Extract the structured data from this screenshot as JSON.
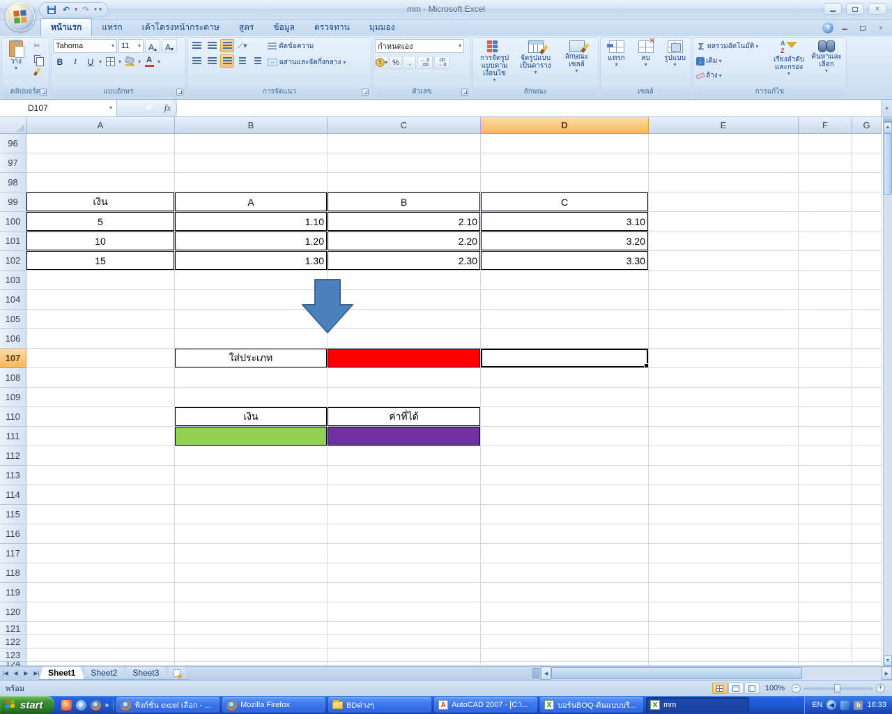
{
  "window": {
    "title": "mm - Microsoft Excel"
  },
  "ribbon_tabs": [
    {
      "label": "หน้าแรก",
      "active": true
    },
    {
      "label": "แทรก"
    },
    {
      "label": "เค้าโครงหน้ากระดาษ"
    },
    {
      "label": "สูตร"
    },
    {
      "label": "ข้อมูล"
    },
    {
      "label": "ตรวจทาน"
    },
    {
      "label": "มุมมอง"
    }
  ],
  "ribbon": {
    "clipboard": {
      "label": "คลิปบอร์ด",
      "paste": "วาง"
    },
    "font": {
      "label": "แบบอักษร",
      "font_name": "Tahoma",
      "font_size": "11",
      "bold": "B",
      "italic": "I",
      "underline": "U"
    },
    "alignment": {
      "label": "การจัดแนว",
      "wrap_text": "ตัดข้อความ",
      "merge_center": "ผสานและจัดกึ่งกลาง"
    },
    "number": {
      "label": "ตัวเลข",
      "format": "กำหนดเอง",
      "percent": "%",
      "comma": ","
    },
    "styles": {
      "label": "ลักษณะ",
      "conditional": "การจัดรูปแบบตามเงื่อนไข",
      "format_table": "จัดรูปแบบเป็นตาราง",
      "cell_styles": "ลักษณะเซลล์"
    },
    "cells": {
      "label": "เซลล์",
      "insert": "แทรก",
      "delete": "ลบ",
      "format": "รูปแบบ"
    },
    "editing": {
      "label": "การแก้ไข",
      "autosum": "ผลรวมอัตโนมัติ",
      "fill": "เติม",
      "clear": "ล้าง",
      "sort_filter": "เรียงลำดับและกรอง",
      "find_select": "ค้นหาและเลือก"
    }
  },
  "formula_bar": {
    "name_box": "D107",
    "fx": "fx",
    "value": ""
  },
  "grid": {
    "columns": [
      "A",
      "B",
      "C",
      "D",
      "E",
      "F",
      "G"
    ],
    "selected_column": "D",
    "row_start": 96,
    "row_end": 124,
    "selected_row": 107,
    "selected_cell": "D107",
    "cells": [
      {
        "r": 99,
        "c": "A",
        "v": "เงิน",
        "align": "center",
        "border": true
      },
      {
        "r": 99,
        "c": "B",
        "v": "A",
        "align": "center",
        "border": true
      },
      {
        "r": 99,
        "c": "C",
        "v": "B",
        "align": "center",
        "border": true
      },
      {
        "r": 99,
        "c": "D",
        "v": "C",
        "align": "center",
        "border": true
      },
      {
        "r": 100,
        "c": "A",
        "v": "5",
        "align": "center",
        "border": true
      },
      {
        "r": 100,
        "c": "B",
        "v": "1.10",
        "align": "right",
        "border": true
      },
      {
        "r": 100,
        "c": "C",
        "v": "2.10",
        "align": "right",
        "border": true
      },
      {
        "r": 100,
        "c": "D",
        "v": "3.10",
        "align": "right",
        "border": true
      },
      {
        "r": 101,
        "c": "A",
        "v": "10",
        "align": "center",
        "border": true
      },
      {
        "r": 101,
        "c": "B",
        "v": "1.20",
        "align": "right",
        "border": true
      },
      {
        "r": 101,
        "c": "C",
        "v": "2.20",
        "align": "right",
        "border": true
      },
      {
        "r": 101,
        "c": "D",
        "v": "3.20",
        "align": "right",
        "border": true
      },
      {
        "r": 102,
        "c": "A",
        "v": "15",
        "align": "center",
        "border": true
      },
      {
        "r": 102,
        "c": "B",
        "v": "1.30",
        "align": "right",
        "border": true
      },
      {
        "r": 102,
        "c": "C",
        "v": "2.30",
        "align": "right",
        "border": true
      },
      {
        "r": 102,
        "c": "D",
        "v": "3.30",
        "align": "right",
        "border": true
      },
      {
        "r": 107,
        "c": "B",
        "v": "ใส่ประเภท",
        "align": "center",
        "border": true
      },
      {
        "r": 107,
        "c": "C",
        "v": "",
        "bg": "#FF0000",
        "border": true
      },
      {
        "r": 107,
        "c": "D",
        "v": "",
        "sel": true
      },
      {
        "r": 110,
        "c": "B",
        "v": "เงิน",
        "align": "center",
        "border": true
      },
      {
        "r": 110,
        "c": "C",
        "v": "ค่าที่ได้",
        "align": "center",
        "border": true
      },
      {
        "r": 111,
        "c": "B",
        "v": "",
        "bg": "#92D050",
        "border": true
      },
      {
        "r": 111,
        "c": "C",
        "v": "",
        "bg": "#7030A0",
        "border": true
      }
    ],
    "arrow_color": "#4C80BE"
  },
  "sheet_tabs": [
    {
      "label": "Sheet1",
      "active": true
    },
    {
      "label": "Sheet2",
      "active": false
    },
    {
      "label": "Sheet3",
      "active": false
    }
  ],
  "status_bar": {
    "ready": "พร้อม",
    "zoom": "100%"
  },
  "taskbar": {
    "start": "start",
    "windows": [
      {
        "icon": "firefox-icon",
        "label": "ฟังก์ชั่น excel เลือก - ...",
        "active": false
      },
      {
        "icon": "firefox-icon",
        "label": "Mozilla Firefox",
        "active": false
      },
      {
        "icon": "folder-icon",
        "label": "BDต่างๆ",
        "active": false
      },
      {
        "icon": "autocad-icon",
        "label": "AutoCAD 2007 - [C:\\...",
        "active": false
      },
      {
        "icon": "excel-icon",
        "label": "บอร์นBOQ-ต้นแบบบริ...",
        "active": false
      },
      {
        "icon": "excel-icon",
        "label": "mm",
        "active": true
      }
    ],
    "tray": {
      "lang": "EN",
      "time": "16:33"
    }
  }
}
